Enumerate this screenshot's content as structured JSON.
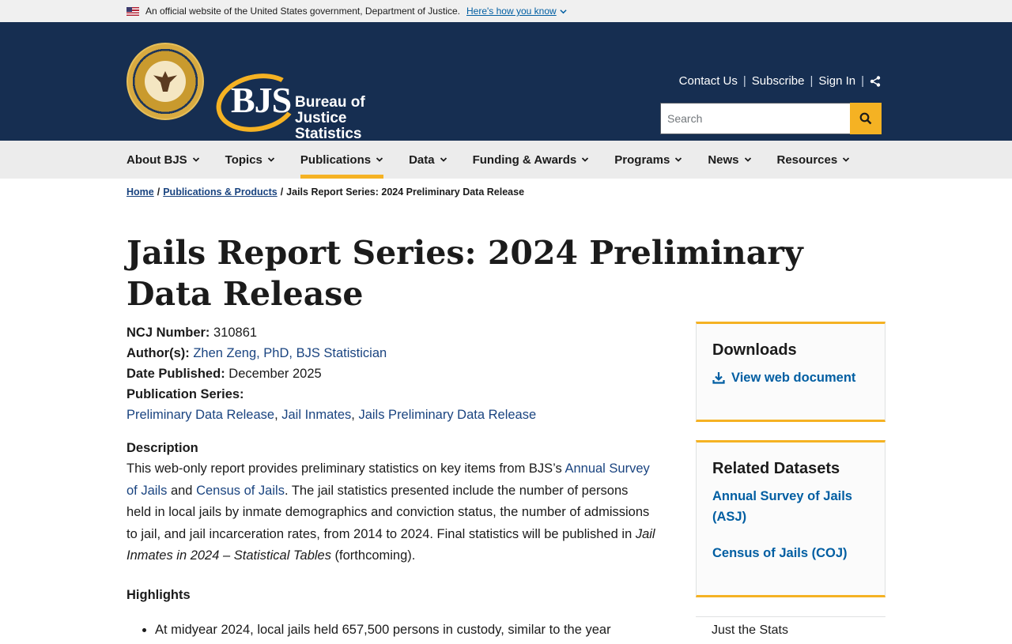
{
  "gov_banner": {
    "text": "An official website of the United States government, Department of Justice.",
    "how_link": "Here's how you know"
  },
  "header": {
    "logo_letters": "BJS",
    "logo_line1": "Bureau of",
    "logo_line2": "Justice Statistics",
    "util_links": [
      "Contact Us",
      "Subscribe",
      "Sign In"
    ],
    "search_placeholder": "Search"
  },
  "nav": {
    "items": [
      "About BJS",
      "Topics",
      "Publications",
      "Data",
      "Funding & Awards",
      "Programs",
      "News",
      "Resources"
    ],
    "active": "Publications"
  },
  "breadcrumb": {
    "home": "Home",
    "section": "Publications & Products",
    "current": "Jails Report Series: 2024 Preliminary Data Release"
  },
  "page": {
    "title": "Jails Report Series: 2024 Preliminary Data Release",
    "ncj_label": "NCJ Number:",
    "ncj_value": "310861",
    "author_label": "Author(s):",
    "author_value": "Zhen Zeng, PhD, BJS Statistician",
    "date_label": "Date Published:",
    "date_value": "December 2025",
    "series_label": "Publication Series:",
    "series_links": [
      "Preliminary Data Release",
      "Jail Inmates",
      "Jails Preliminary Data Release"
    ],
    "description_heading": "Description",
    "desc_part1": "This web-only report provides preliminary statistics on key items from BJS’s ",
    "desc_link1": "Annual Survey of Jails",
    "desc_part2": " and ",
    "desc_link2": "Census of Jails",
    "desc_part3": ". The jail statistics presented include the number of persons held in local jails by inmate demographics and conviction status, the number of admissions to jail, and jail incarceration rates, from 2014 to 2024. Final statistics will be published in ",
    "desc_italic": "Jail Inmates in 2024 – Statistical Tables",
    "desc_part4": " (forthcoming).",
    "highlights_heading": "Highlights",
    "highlight_1": "At midyear 2024, local jails held 657,500 persons in custody, similar to the year"
  },
  "sidebar": {
    "downloads_heading": "Downloads",
    "download_link": "View web document",
    "related_heading": "Related Datasets",
    "related_links": [
      "Annual Survey of Jails (ASJ)",
      "Census of Jails (COJ)"
    ],
    "next_heading": "Just the Stats"
  }
}
